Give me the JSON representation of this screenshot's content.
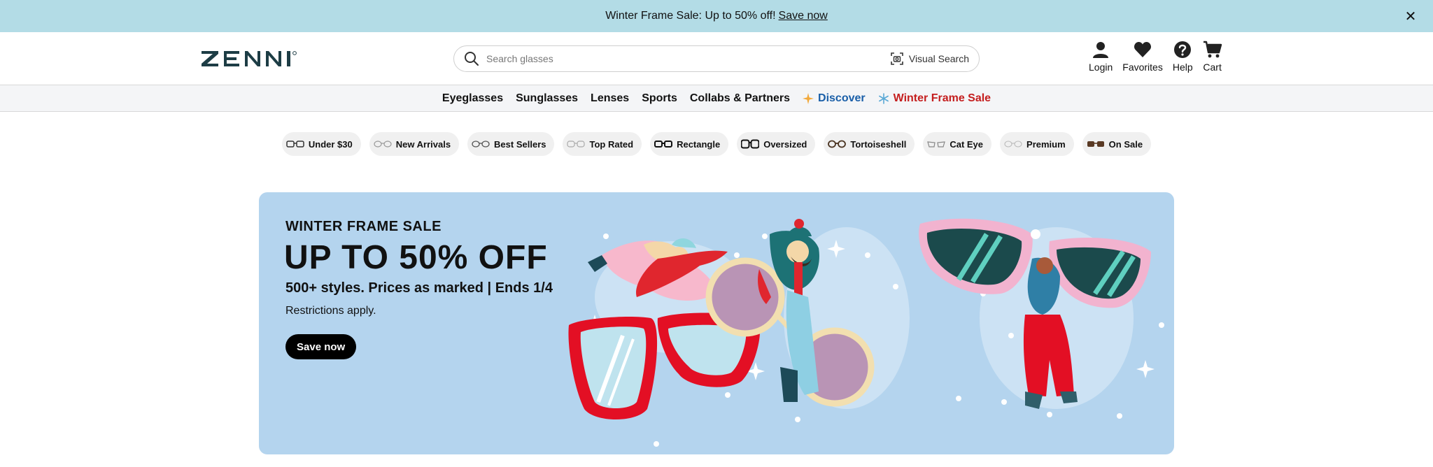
{
  "promo": {
    "text": "Winter Frame Sale: Up to 50% off!",
    "link": "Save now",
    "close_icon": "close-icon"
  },
  "header": {
    "logo_text": "ZENNI",
    "search": {
      "placeholder": "Search glasses",
      "visual_search_label": "Visual Search"
    },
    "actions": [
      {
        "label": "Login",
        "icon": "user-icon"
      },
      {
        "label": "Favorites",
        "icon": "heart-icon"
      },
      {
        "label": "Help",
        "icon": "help-icon"
      },
      {
        "label": "Cart",
        "icon": "cart-icon"
      }
    ]
  },
  "nav": {
    "items": [
      "Eyeglasses",
      "Sunglasses",
      "Lenses",
      "Sports",
      "Collabs & Partners"
    ],
    "discover": "Discover",
    "sale": "Winter Frame Sale"
  },
  "chips": [
    "Under $30",
    "New Arrivals",
    "Best Sellers",
    "Top Rated",
    "Rectangle",
    "Oversized",
    "Tortoiseshell",
    "Cat Eye",
    "Premium",
    "On Sale"
  ],
  "hero": {
    "eyebrow": "WINTER FRAME SALE",
    "headline": "UP TO 50% OFF",
    "subhead": "500+ styles. Prices as marked | Ends 1/4",
    "note": "Restrictions apply.",
    "cta": "Save now"
  },
  "colors": {
    "promo_bg": "#b3dce6",
    "hero_bg": "#b4d4ee",
    "discover": "#1a5fa8",
    "sale": "#c41e1e",
    "logo": "#1d3d45"
  }
}
